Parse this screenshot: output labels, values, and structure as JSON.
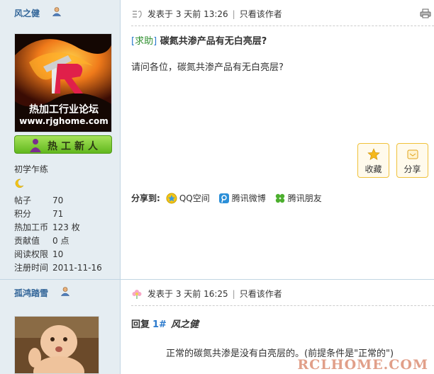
{
  "posts": [
    {
      "author": "风之健",
      "avatar_lines": [
        "热加工行业论坛",
        "www.rjghome.com"
      ],
      "rank_badge": "热工新人",
      "rank_title": "初学乍练",
      "stats": [
        {
          "k": "帖子",
          "v": "70"
        },
        {
          "k": "积分",
          "v": "71"
        },
        {
          "k": "热加工币",
          "v": "123 枚"
        },
        {
          "k": "贡献值",
          "v": "0 点"
        },
        {
          "k": "阅读权限",
          "v": "10"
        },
        {
          "k": "注册时间",
          "v": "2011-11-16"
        }
      ],
      "posted": "发表于 3 天前 13:26",
      "sep": "|",
      "only_author": "只看该作者",
      "title_tag": "求助",
      "title": "碳氮共渗产品有无白亮层?",
      "body": "请问各位，碳氮共渗产品有无白亮层?",
      "fav_label": "收藏",
      "share_btn_label": "分享",
      "share_to": "分享到:",
      "share_targets": [
        "QQ空间",
        "腾讯微博",
        "腾讯朋友"
      ]
    },
    {
      "author": "孤鸿踏雪",
      "posted": "发表于 3 天前 16:25",
      "sep": "|",
      "only_author": "只看该作者",
      "reply_label": "回复",
      "reply_floor": "1#",
      "reply_to": "风之健",
      "body": "正常的碳氮共渗是没有白亮层的。(前提条件是\"正常的\")"
    }
  ],
  "watermark": "RCLHOME.COM",
  "icons": [
    "user-icon",
    "post-icon",
    "printer-icon",
    "moon-icon",
    "star-icon",
    "share-icon",
    "qzone-icon",
    "tencent-weibo-icon",
    "clover-icon",
    "flower-icon"
  ],
  "colors": {
    "sidebar_bg": "#e5edf2",
    "link": "#336699",
    "button_border": "#f0c13a"
  }
}
